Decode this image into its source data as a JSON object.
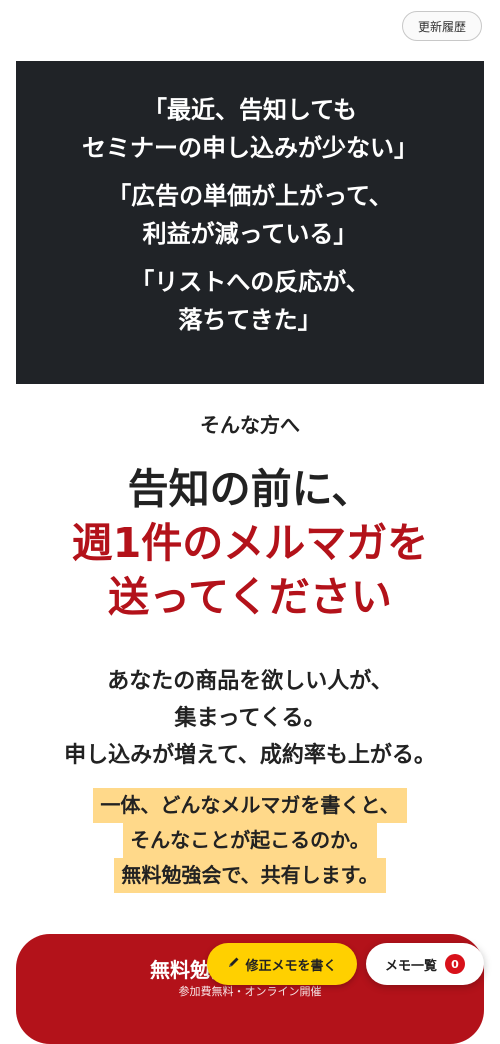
{
  "header": {
    "history_button": "更新履歴"
  },
  "pain_points": [
    {
      "lines": [
        "「最近、告知しても",
        "セミナーの申し込みが少ない」"
      ]
    },
    {
      "lines": [
        "「広告の単価が上がって、",
        "利益が減っている」"
      ]
    },
    {
      "lines": [
        "「リストへの反応が、",
        "落ちてきた」"
      ]
    }
  ],
  "lead": "そんな方へ",
  "headline": {
    "line1": "告知の前に、",
    "line2": "週1件のメルマガを",
    "line3": "送ってください"
  },
  "sub": {
    "line1": "あなたの商品を欲しい人が、",
    "line2": "集まってくる。",
    "line3": "申し込みが増えて、成約率も上がる。"
  },
  "highlight": {
    "line1": "一体、どんなメルマガを書くと、",
    "line2": "そんなことが起こるのか。",
    "line3": "無料勉強会で、共有します。"
  },
  "cta": {
    "label": "無料勉強会に申し込む",
    "sub": "参加費無料・オンライン開催"
  },
  "floating": {
    "memo_button": "修正メモを書く",
    "memo_icon": "pencil-icon",
    "memo_list_button": "メモ一覧",
    "memo_count": "0"
  },
  "colors": {
    "dark_panel": "#202327",
    "accent_red": "#b3121a",
    "highlight_yellow": "#ffd98a",
    "memo_yellow": "#ffd000",
    "badge_red": "#d8111a"
  }
}
